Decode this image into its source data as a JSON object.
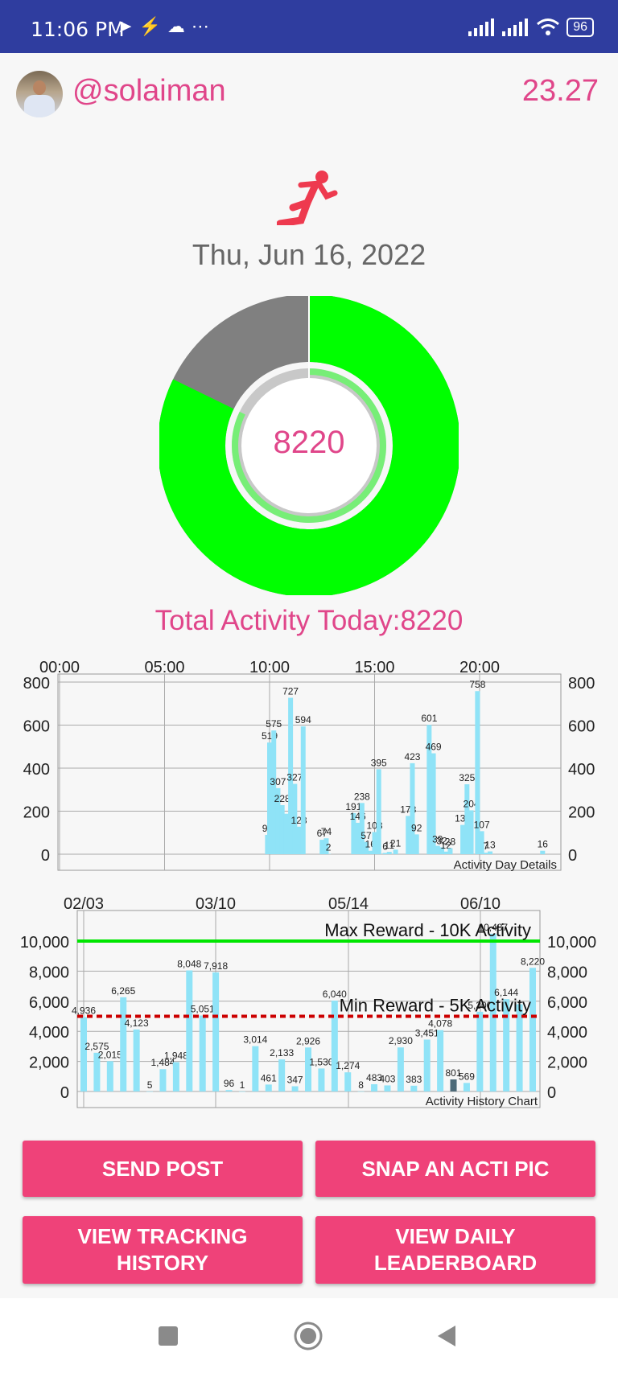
{
  "status_bar": {
    "time": "11:06 PM",
    "battery": "96"
  },
  "header": {
    "username": "@solaiman",
    "balance": "23.27"
  },
  "date": "Thu, Jun 16, 2022",
  "today": {
    "steps": "8220",
    "total_label": "Total Activity Today:8220"
  },
  "colors": {
    "accent": "#e0468a",
    "button": "#ef4279",
    "progress": "#00ff00",
    "remaining": "#808080",
    "bar": "#8fe3f7",
    "status_bar": "#2f3d9f"
  },
  "chart_data": [
    {
      "type": "bar",
      "title": "Activity Day Details",
      "x_ticks": [
        "00:00",
        "05:00",
        "10:00",
        "15:00",
        "20:00"
      ],
      "x_domain": [
        0,
        24
      ],
      "ylim": [
        0,
        800
      ],
      "y_ticks": [
        "800",
        "600",
        "400",
        "200",
        "0"
      ],
      "grid": true,
      "points": [
        {
          "x": 9.9,
          "y": 90,
          "label": "90"
        },
        {
          "x": 10.0,
          "y": 519,
          "label": "519"
        },
        {
          "x": 10.2,
          "y": 575,
          "label": "575"
        },
        {
          "x": 10.4,
          "y": 307,
          "label": "307"
        },
        {
          "x": 10.6,
          "y": 228,
          "label": "228"
        },
        {
          "x": 10.8,
          "y": 188,
          "label": ""
        },
        {
          "x": 11.0,
          "y": 727,
          "label": "727"
        },
        {
          "x": 11.2,
          "y": 327,
          "label": "327"
        },
        {
          "x": 11.4,
          "y": 128,
          "label": "128"
        },
        {
          "x": 11.6,
          "y": 594,
          "label": "594"
        },
        {
          "x": 12.5,
          "y": 67,
          "label": "67"
        },
        {
          "x": 12.7,
          "y": 74,
          "label": "74"
        },
        {
          "x": 12.8,
          "y": 2,
          "label": "2"
        },
        {
          "x": 14.0,
          "y": 191,
          "label": "191"
        },
        {
          "x": 14.2,
          "y": 146,
          "label": "146"
        },
        {
          "x": 14.4,
          "y": 238,
          "label": "238"
        },
        {
          "x": 14.6,
          "y": 57,
          "label": "57"
        },
        {
          "x": 14.8,
          "y": 16,
          "label": "16"
        },
        {
          "x": 15.0,
          "y": 103,
          "label": "103"
        },
        {
          "x": 15.2,
          "y": 395,
          "label": "395"
        },
        {
          "x": 15.5,
          "y": 6,
          "label": "6"
        },
        {
          "x": 15.7,
          "y": 11,
          "label": "11"
        },
        {
          "x": 16.0,
          "y": 21,
          "label": "21"
        },
        {
          "x": 16.6,
          "y": 178,
          "label": "178"
        },
        {
          "x": 16.8,
          "y": 423,
          "label": "423"
        },
        {
          "x": 17.0,
          "y": 92,
          "label": "92"
        },
        {
          "x": 17.6,
          "y": 601,
          "label": "601"
        },
        {
          "x": 17.8,
          "y": 469,
          "label": "469"
        },
        {
          "x": 18.0,
          "y": 39,
          "label": "39"
        },
        {
          "x": 18.2,
          "y": 32,
          "label": "32"
        },
        {
          "x": 18.4,
          "y": 12,
          "label": "12"
        },
        {
          "x": 18.6,
          "y": 28,
          "label": "28"
        },
        {
          "x": 19.2,
          "y": 136,
          "label": "136"
        },
        {
          "x": 19.4,
          "y": 325,
          "label": "325"
        },
        {
          "x": 19.6,
          "y": 204,
          "label": "204"
        },
        {
          "x": 19.9,
          "y": 758,
          "label": "758"
        },
        {
          "x": 20.1,
          "y": 107,
          "label": "107"
        },
        {
          "x": 20.3,
          "y": 7,
          "label": "7"
        },
        {
          "x": 20.5,
          "y": 13,
          "label": "13"
        },
        {
          "x": 23.0,
          "y": 16,
          "label": "16"
        }
      ]
    },
    {
      "type": "bar",
      "title": "Activity History Chart",
      "x_ticks": [
        "02/03",
        "03/10",
        "05/14",
        "06/10"
      ],
      "ylim": [
        0,
        11000
      ],
      "y_ticks": [
        "10,000",
        "8,000",
        "6,000",
        "4,000",
        "2,000",
        "0"
      ],
      "grid": true,
      "reference_lines": [
        {
          "name": "Max Reward - 10K Activity",
          "y": 10000,
          "color": "#00e600",
          "style": "solid"
        },
        {
          "name": "Min Reward - 5K Activity",
          "y": 5000,
          "color": "#cc0000",
          "style": "dashed"
        }
      ],
      "values": [
        4936,
        2575,
        2015,
        6265,
        4123,
        5,
        1484,
        1948,
        8048,
        5051,
        7918,
        96,
        1,
        3014,
        461,
        2133,
        347,
        2926,
        1530,
        6040,
        1274,
        8,
        483,
        403,
        2930,
        383,
        3451,
        4078,
        801,
        569,
        5300,
        10487,
        6144,
        5800,
        8220
      ],
      "labels": [
        "4,936",
        "2,575",
        "2,015",
        "6,265",
        "4,123",
        "5",
        "1,484",
        "1,948",
        "8,048",
        "5,051",
        "7,918",
        "96",
        "1",
        "3,014",
        "461",
        "2,133",
        "347",
        "2,926",
        "1,530",
        "6,040",
        "1,274",
        "8",
        "483",
        "403",
        "2,930",
        "383",
        "3,451",
        "4,078",
        "801",
        "569",
        "5,300",
        "10,487",
        "6,144",
        "",
        "8,220"
      ],
      "highlight_index": 28
    }
  ],
  "buttons": {
    "send_post": "SEND POST",
    "snap_pic": "SNAP AN ACTI PIC",
    "tracking_line1": "VIEW TRACKING",
    "tracking_line2": "HISTORY",
    "leaderboard_line1": "VIEW DAILY",
    "leaderboard_line2": "LEADERBOARD"
  },
  "icons": {
    "run": "running-person-icon",
    "send": "telegram-icon",
    "cloud": "cloud-icon",
    "wifi": "wifi-icon",
    "signal": "signal-icon",
    "back": "back-icon",
    "home": "home-icon",
    "recent": "recent-apps-icon"
  }
}
